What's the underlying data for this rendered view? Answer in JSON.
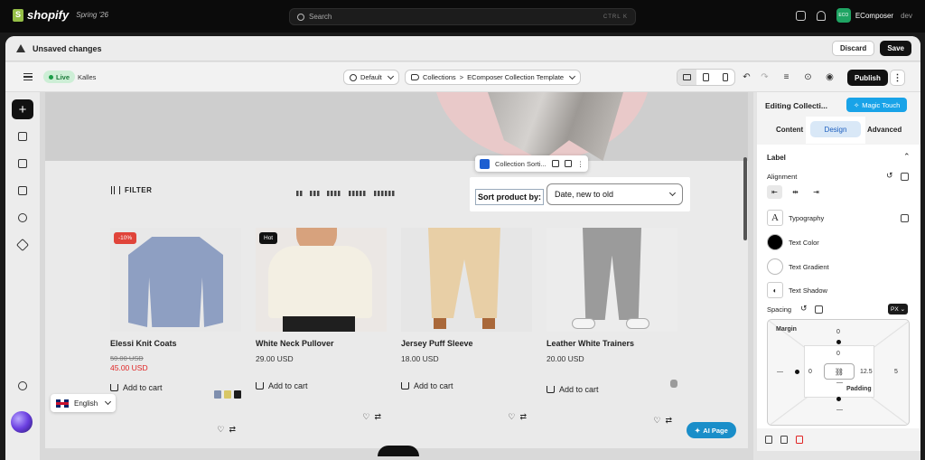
{
  "topbar": {
    "brand": "shopify",
    "edition": "Spring '26",
    "search_placeholder": "Search",
    "search_shortcut": "CTRL K",
    "store_initials": "ECO",
    "store_name": "EComposer",
    "store_env": "dev"
  },
  "unsaved": {
    "message": "Unsaved changes",
    "discard_label": "Discard",
    "save_label": "Save"
  },
  "toolbar": {
    "live_label": "Live",
    "theme_name": "Kalles",
    "language_label": "Default",
    "breadcrumb_root": "Collections",
    "breadcrumb_sep": ">",
    "breadcrumb_template": "EComposer Collection Template",
    "publish_label": "Publish"
  },
  "element_toolbar": {
    "label": "Collection Sorti..."
  },
  "storefront": {
    "filter_label": "FILTER",
    "sort_label": "Sort product by:",
    "sort_value": "Date, new to old",
    "products": [
      {
        "name": "Elessi Knit Coats",
        "badge": "-10%",
        "old_price": "50.00 USD",
        "price": "45.00 USD",
        "add_label": "Add to cart",
        "swatches": [
          "#7f8fae",
          "#d8c766",
          "#1c1c1c"
        ]
      },
      {
        "name": "White Neck Pullover",
        "badge": "Hot",
        "price": "29.00 USD",
        "add_label": "Add to cart"
      },
      {
        "name": "Jersey Puff Sleeve",
        "price": "18.00 USD",
        "add_label": "Add to cart"
      },
      {
        "name": "Leather White Trainers",
        "price": "20.00 USD",
        "add_label": "Add to cart"
      }
    ],
    "language": "English",
    "ai_page_label": "AI Page"
  },
  "panel": {
    "title": "Editing Collecti...",
    "magic_label": "Magic Touch",
    "tabs": [
      "Content",
      "Design",
      "Advanced"
    ],
    "active_tab": "Design",
    "section_label": "Label",
    "alignment_label": "Alignment",
    "typography_label": "Typography",
    "text_color_label": "Text Color",
    "text_gradient_label": "Text Gradient",
    "text_shadow_label": "Text Shadow",
    "spacing_label": "Spacing",
    "unit": "PX",
    "margin_label": "Margin",
    "padding_label": "Padding",
    "margin_top": "0",
    "padding_top": "0",
    "margin_left": "—",
    "padding_left": "0",
    "padding_right": "12.5",
    "margin_right": "5",
    "padding_bottom": "—",
    "margin_bottom": "—"
  },
  "colors": {
    "accent": "#1d5fd1",
    "live": "#1b9d48",
    "sale": "#e02424",
    "magic": "#19a3e8",
    "badge_sale": "#e0443a",
    "badge_hot": "#111111"
  }
}
